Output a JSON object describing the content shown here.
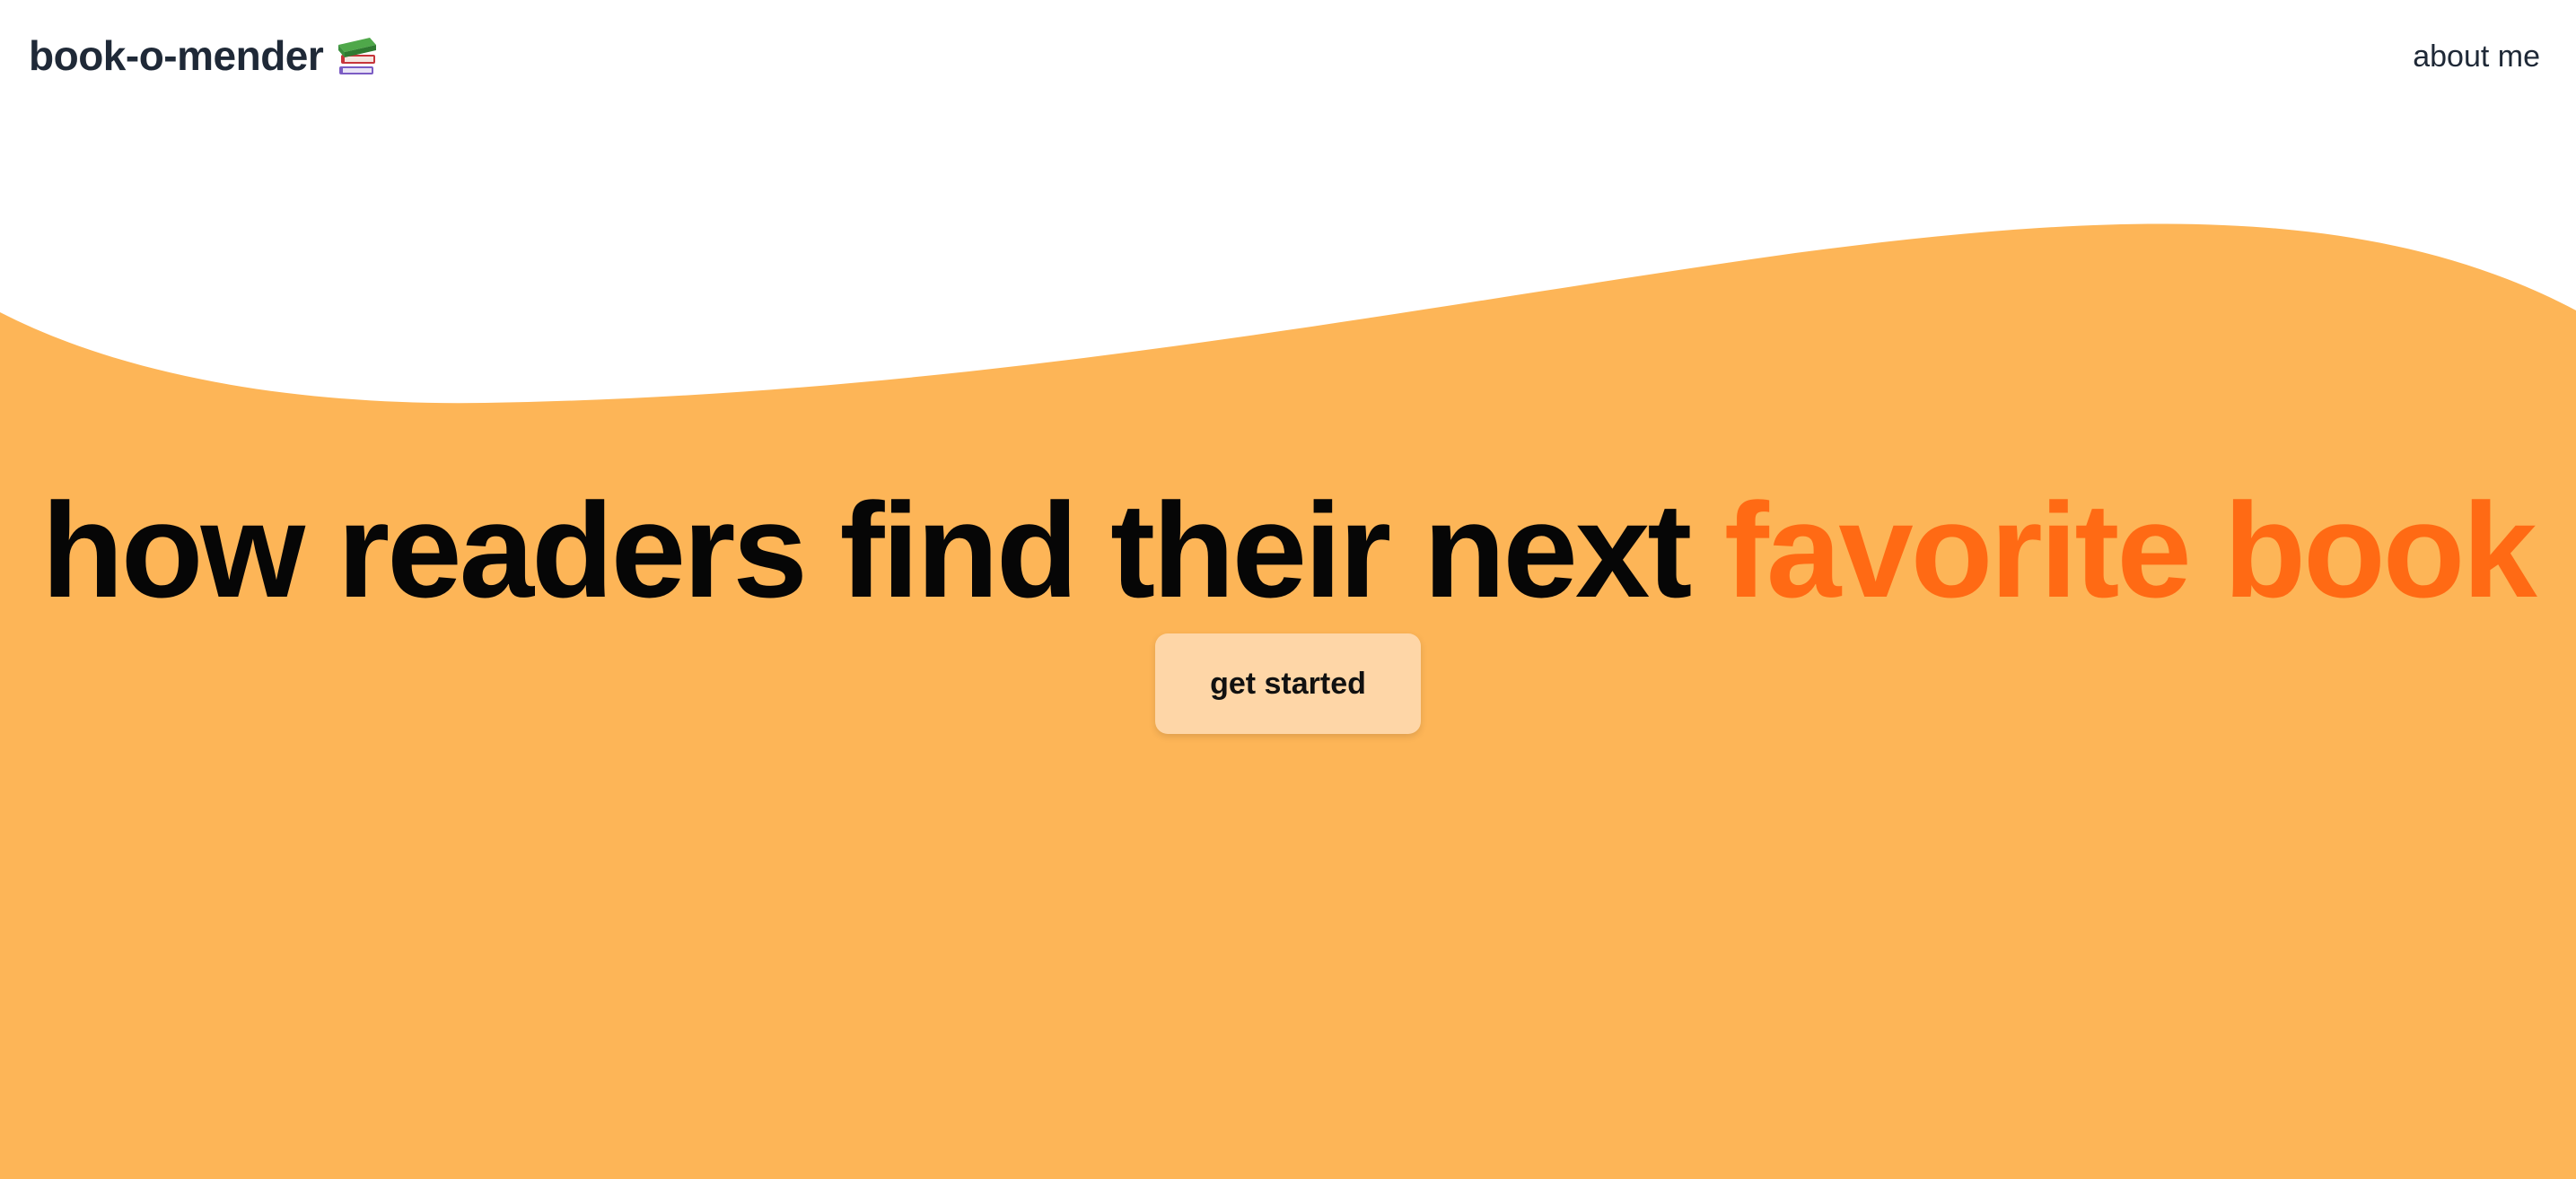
{
  "app": {
    "brand_name": "book-o-mender",
    "brand_icon": "books-icon"
  },
  "nav": {
    "about_label": "about me"
  },
  "hero": {
    "headline_main": "how readers find their next ",
    "headline_accent": "favorite book",
    "cta_label": "get started"
  },
  "colors": {
    "background": "#ffffff",
    "wave_fill": "#fdb557",
    "accent": "#ff6a14",
    "cta_background": "#fed6a7",
    "text_dark": "#1f2937"
  }
}
